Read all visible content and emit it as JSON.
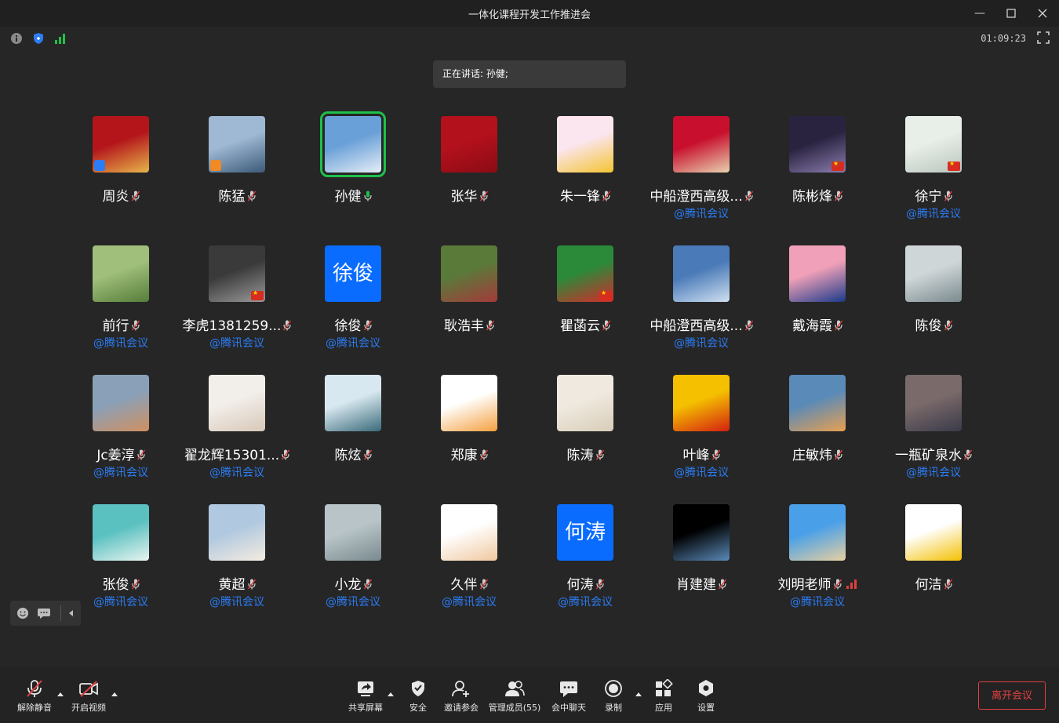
{
  "window": {
    "title": "一体化课程开发工作推进会"
  },
  "status": {
    "timer": "01:09:23"
  },
  "speaking": {
    "label": "正在讲话: 孙健;"
  },
  "participants": [
    {
      "name": "周炎",
      "sub": "",
      "colors": [
        "#b3151b",
        "#e8b54a"
      ],
      "badge": "dl"
    },
    {
      "name": "陈猛",
      "sub": "",
      "colors": [
        "#9fb9d4",
        "#3b5a78"
      ],
      "badge": "dl"
    },
    {
      "name": "孙健",
      "sub": "",
      "colors": [
        "#6aa0d8",
        "#e6eef6"
      ],
      "badge": "",
      "active": true
    },
    {
      "name": "张华",
      "sub": "",
      "colors": [
        "#b3111c",
        "#8b0b14"
      ],
      "badge": ""
    },
    {
      "name": "朱一锋",
      "sub": "",
      "colors": [
        "#fbe6f0",
        "#f4c430"
      ],
      "badge": ""
    },
    {
      "name": "中船澄西高级...",
      "sub": "@腾讯会议",
      "colors": [
        "#c8102e",
        "#e8d2b0"
      ],
      "badge": ""
    },
    {
      "name": "陈彬烽",
      "sub": "",
      "colors": [
        "#2a2340",
        "#8a7db0"
      ],
      "badge": "cn"
    },
    {
      "name": "徐宁",
      "sub": "@腾讯会议",
      "colors": [
        "#e8eee8",
        "#b9c6bd"
      ],
      "badge": "cn"
    },
    {
      "name": "前行",
      "sub": "@腾讯会议",
      "colors": [
        "#9fbf7a",
        "#567d3a"
      ],
      "badge": ""
    },
    {
      "name": "李虎1381259...",
      "sub": "@腾讯会议",
      "colors": [
        "#3a3a3a",
        "#9a9a9a"
      ],
      "badge": "cn"
    },
    {
      "name": "徐俊",
      "sub": "@腾讯会议",
      "colors": [
        "#0a6cff",
        "#0a6cff"
      ],
      "badge": "",
      "text": "徐俊"
    },
    {
      "name": "耿浩丰",
      "sub": "",
      "colors": [
        "#5a7a3a",
        "#a33a3a"
      ],
      "badge": ""
    },
    {
      "name": "瞿菡云",
      "sub": "",
      "colors": [
        "#2a8a3a",
        "#d42a2a"
      ],
      "badge": "cn"
    },
    {
      "name": "中船澄西高级...",
      "sub": "@腾讯会议",
      "colors": [
        "#4a7ab8",
        "#cfe0f0"
      ],
      "badge": ""
    },
    {
      "name": "戴海霞",
      "sub": "",
      "colors": [
        "#f0a0b8",
        "#1a3a8a"
      ],
      "badge": ""
    },
    {
      "name": "陈俊",
      "sub": "",
      "colors": [
        "#cfd6d8",
        "#7a8a8e"
      ],
      "badge": ""
    },
    {
      "name": "Jc姜淳",
      "sub": "@腾讯会议",
      "colors": [
        "#8aa0b8",
        "#d09060"
      ],
      "badge": ""
    },
    {
      "name": "翟龙辉15301...",
      "sub": "@腾讯会议",
      "colors": [
        "#f2eeea",
        "#d8c8b8"
      ],
      "badge": ""
    },
    {
      "name": "陈炫",
      "sub": "",
      "colors": [
        "#d8e8f0",
        "#3a6a7a"
      ],
      "badge": ""
    },
    {
      "name": "郑康",
      "sub": "",
      "colors": [
        "#ffffff",
        "#f4a040"
      ],
      "badge": ""
    },
    {
      "name": "陈涛",
      "sub": "",
      "colors": [
        "#efe9df",
        "#d8cdb8"
      ],
      "badge": ""
    },
    {
      "name": "叶峰",
      "sub": "@腾讯会议",
      "colors": [
        "#f4c000",
        "#d42010"
      ],
      "badge": ""
    },
    {
      "name": "庄敏炜",
      "sub": "",
      "colors": [
        "#5a8ab8",
        "#e8a050"
      ],
      "badge": ""
    },
    {
      "name": "一瓶矿泉水",
      "sub": "@腾讯会议",
      "colors": [
        "#7a6a6a",
        "#3a3a4a"
      ],
      "badge": ""
    },
    {
      "name": "张俊",
      "sub": "@腾讯会议",
      "colors": [
        "#5ac0c0",
        "#e8f4f0"
      ],
      "badge": ""
    },
    {
      "name": "黄超",
      "sub": "@腾讯会议",
      "colors": [
        "#b0c8e0",
        "#f4ece0"
      ],
      "badge": ""
    },
    {
      "name": "小龙",
      "sub": "@腾讯会议",
      "colors": [
        "#b8c4c8",
        "#7a8a8e"
      ],
      "badge": ""
    },
    {
      "name": "久伴",
      "sub": "@腾讯会议",
      "colors": [
        "#ffffff",
        "#f0c8a0"
      ],
      "badge": ""
    },
    {
      "name": "何涛",
      "sub": "@腾讯会议",
      "colors": [
        "#0a6cff",
        "#0a6cff"
      ],
      "badge": "",
      "text": "何涛"
    },
    {
      "name": "肖建建",
      "sub": "",
      "colors": [
        "#000000",
        "#5a8ab8"
      ],
      "badge": ""
    },
    {
      "name": "刘明老师",
      "sub": "@腾讯会议",
      "colors": [
        "#4aa0e8",
        "#e8d0a0"
      ],
      "badge": "",
      "signal": true
    },
    {
      "name": "何洁",
      "sub": "",
      "colors": [
        "#ffffff",
        "#f4c000"
      ],
      "badge": ""
    }
  ],
  "toolbar": {
    "unmute": "解除静音",
    "start_video": "开启视频",
    "share": "共享屏幕",
    "security": "安全",
    "invite": "邀请参会",
    "members": "管理成员(55)",
    "chat": "会中聊天",
    "record": "录制",
    "apps": "应用",
    "settings": "设置",
    "leave": "离开会议"
  },
  "colors": {
    "accent_blue": "#2b7cf5",
    "active_green": "#1fc04a",
    "leave_red": "#e2403f"
  }
}
